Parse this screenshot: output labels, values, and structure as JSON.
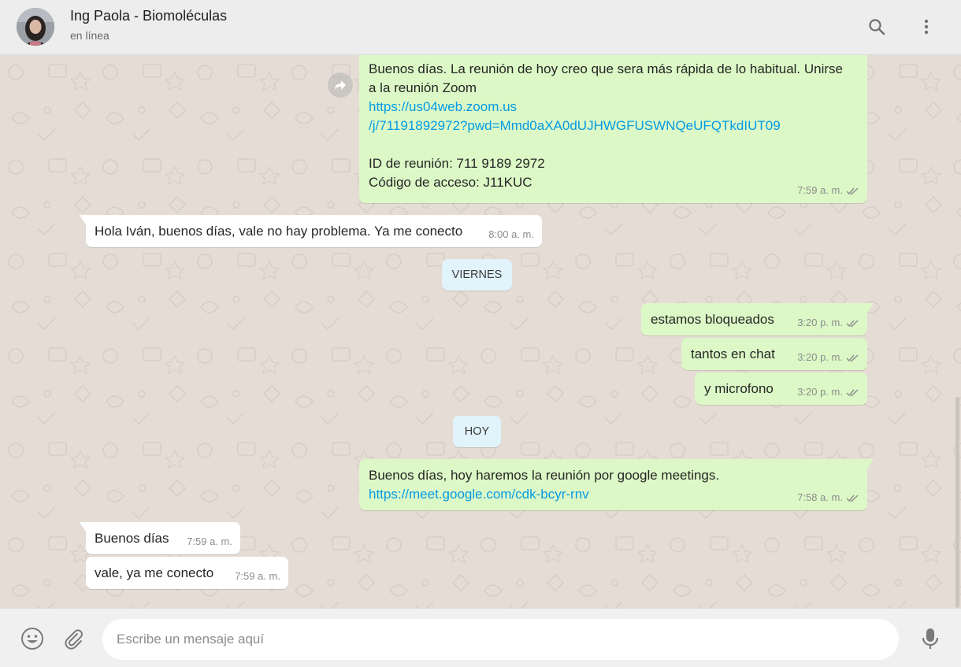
{
  "header": {
    "contact_name": "Ing Paola - Biomoléculas",
    "status": "en línea",
    "icons": [
      "search-icon",
      "menu-icon"
    ]
  },
  "colors": {
    "outgoing_bubble": "#dcf8c6",
    "incoming_bubble": "#ffffff",
    "chat_background": "#e5ddd5",
    "date_pill": "#e1f3fb",
    "link": "#039be5",
    "header_bg": "#ededed"
  },
  "messages": {
    "m1": {
      "direction": "outgoing",
      "lines": [
        "Buenos días. La reunión de hoy creo que sera más rápida de lo habitual. Unirse",
        "a la reunión Zoom"
      ],
      "link_lines": [
        "https://us04web.zoom.us",
        "/j/71191892972?pwd=Mmd0aXA0dUJHWGFUSWNQeUFQTkdIUT09"
      ],
      "detail_lines": [
        "ID de reunión: 711 9189 2972",
        "Código de acceso: J11KUC"
      ],
      "time": "7:59 a. m."
    },
    "m2": {
      "direction": "incoming",
      "text": "Hola Iván, buenos días, vale no hay problema. Ya me conecto",
      "time": "8:00 a. m."
    },
    "date1": "VIERNES",
    "m3": {
      "direction": "outgoing",
      "text": "estamos bloqueados",
      "time": "3:20 p. m."
    },
    "m4": {
      "direction": "outgoing",
      "text": "tantos en chat",
      "time": "3:20 p. m."
    },
    "m5": {
      "direction": "outgoing",
      "text": "y microfono",
      "time": "3:20 p. m."
    },
    "date2": "HOY",
    "m6": {
      "direction": "outgoing",
      "text": "Buenos días, hoy haremos la reunión por google meetings.",
      "link": "https://meet.google.com/cdk-bcyr-rnv",
      "time": "7:58 a. m."
    },
    "m7": {
      "direction": "incoming",
      "text": "Buenos días",
      "time": "7:59 a. m."
    },
    "m8": {
      "direction": "incoming",
      "text": "vale, ya me conecto",
      "time": "7:59 a. m."
    }
  },
  "composer": {
    "placeholder": "Escribe un mensaje aquí",
    "value": "",
    "icons": [
      "emoji-icon",
      "attach-icon",
      "microphone-icon"
    ]
  }
}
